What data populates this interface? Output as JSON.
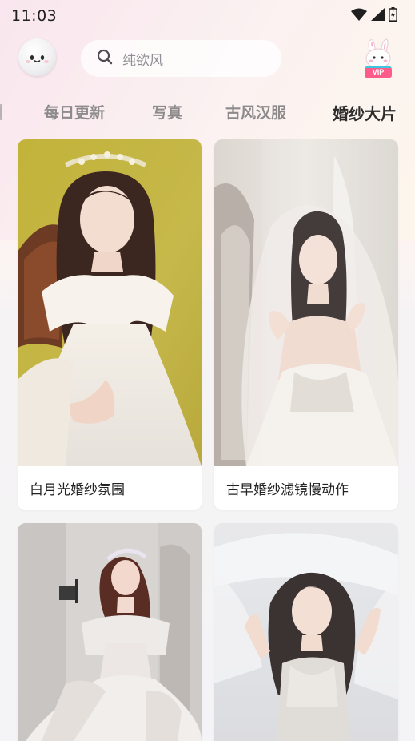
{
  "status_bar": {
    "time": "11:03",
    "icons": [
      "wifi-icon",
      "cell-signal-icon",
      "battery-icon"
    ]
  },
  "header": {
    "avatar_icon": "cartoon-face-avatar",
    "search": {
      "icon": "search-icon",
      "placeholder": "纯欲风"
    },
    "vip": {
      "icon": "bunny-vip-badge-icon",
      "label": "VIP"
    }
  },
  "tabs": [
    {
      "label": "每日更新",
      "active": false
    },
    {
      "label": "写真",
      "active": false
    },
    {
      "label": "古风汉服",
      "active": false
    },
    {
      "label": "婚纱大片",
      "active": true
    }
  ],
  "cards": [
    {
      "title": "白月光婚纱氛围"
    },
    {
      "title": "古早婚纱滤镜慢动作"
    },
    {
      "title": ""
    },
    {
      "title": ""
    }
  ],
  "colors": {
    "active_tab": "#2c2c2c",
    "inactive_tab": "#8d8a8c",
    "vip_badge": "#ff5b8a",
    "card_bg": "#ffffff"
  }
}
